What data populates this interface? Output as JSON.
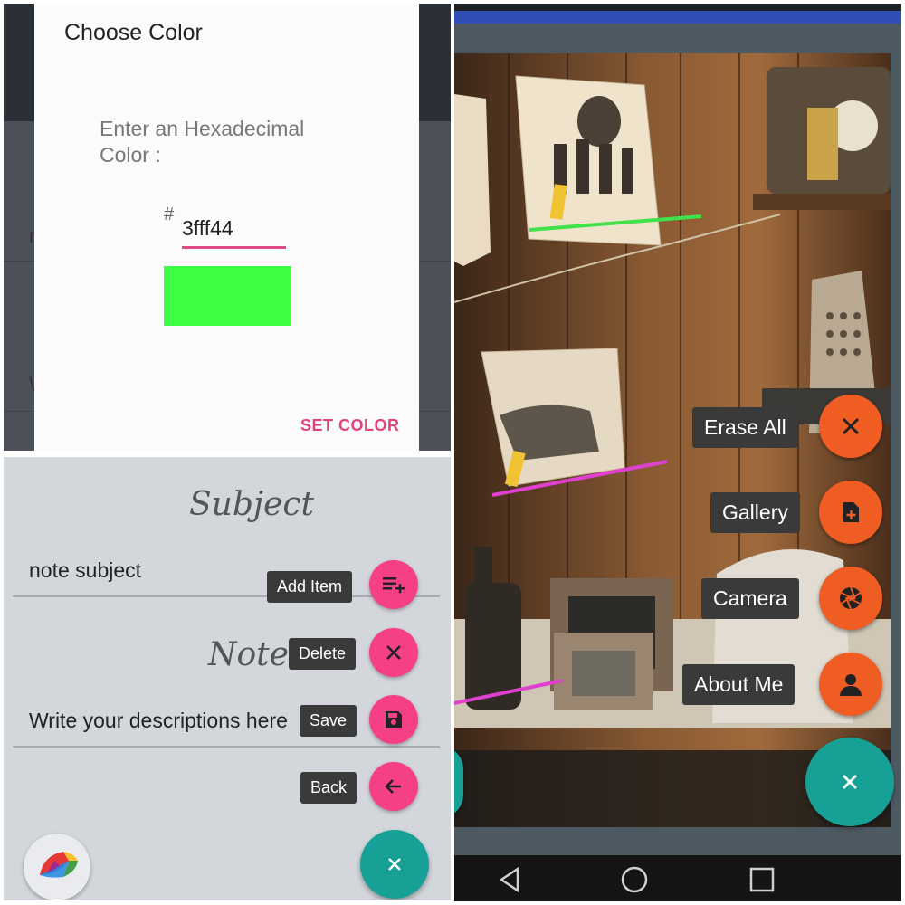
{
  "color_dialog": {
    "title": "Choose Color",
    "label": "Enter an Hexadecimal Color :",
    "hash": "#",
    "hex_value": "3fff44",
    "preview_color": "#3fff44",
    "set_color_label": "SET COLOR",
    "background_fragments": [
      "n",
      "W"
    ]
  },
  "note_editor": {
    "subject_heading": "Subject",
    "subject_value": "note subject",
    "note_heading": "Note",
    "description_value": "Write your descriptions here",
    "menu": [
      {
        "label": "Add Item",
        "icon": "playlist-add-icon"
      },
      {
        "label": "Delete",
        "icon": "close-icon"
      },
      {
        "label": "Save",
        "icon": "floppy-disk-icon"
      },
      {
        "label": "Back",
        "icon": "arrow-left-icon"
      }
    ],
    "accent_color": "#f53f86",
    "fab_color": "#17a095"
  },
  "drawing_app": {
    "menu": [
      {
        "label": "Erase All",
        "icon": "close-icon"
      },
      {
        "label": "Gallery",
        "icon": "file-add-icon"
      },
      {
        "label": "Camera",
        "icon": "camera-shutter-icon"
      },
      {
        "label": "About Me",
        "icon": "person-icon"
      }
    ],
    "accent_color": "#f05d23",
    "fab_color": "#17a095",
    "nav": [
      "back-icon",
      "home-icon",
      "recents-icon"
    ]
  }
}
